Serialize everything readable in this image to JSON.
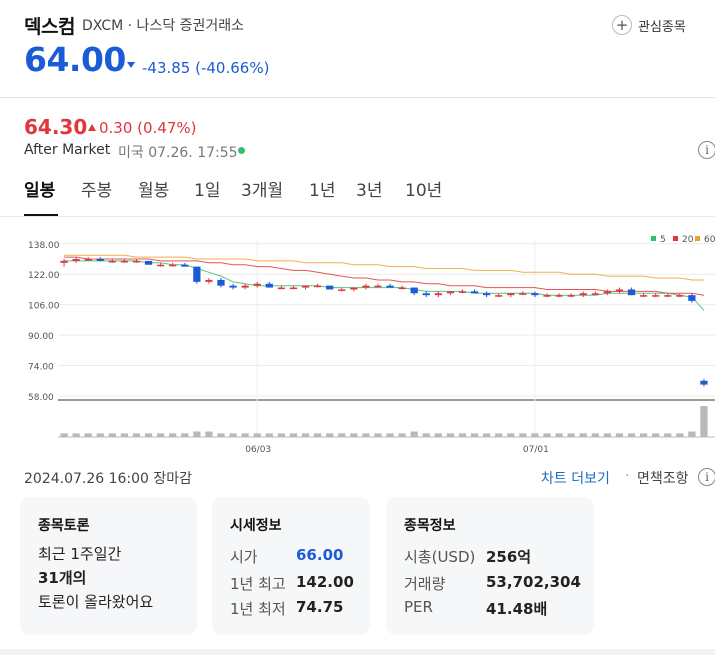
{
  "stock": {
    "name": "덱스컴",
    "ticker_exchange": "DXCM · 나스닥 증권거래소",
    "watch_label": "관심종목",
    "price": "64.00",
    "change": "-43.85 (-40.66%)"
  },
  "after_market": {
    "price": "64.30",
    "change": "0.30 (0.47%)",
    "label": "After Market",
    "time": "미국 07.26. 17:55"
  },
  "tabs": [
    "일봉",
    "주봉",
    "월봉",
    "1일",
    "3개월",
    "1년",
    "3년",
    "10년"
  ],
  "legend": [
    "5",
    "20",
    "60"
  ],
  "colors": {
    "up": "#e0373a",
    "down": "#1c5bd6",
    "ma5": "#2ebf6f",
    "ma20": "#e0373a",
    "ma60": "#f0a030"
  },
  "chart_data": {
    "type": "candlestick",
    "y_ticks": [
      "138.00",
      "122.00",
      "106.00",
      "90.00",
      "74.00",
      "58.00"
    ],
    "ylim": [
      58,
      140
    ],
    "x_ticks": [
      "06/03",
      "07/01"
    ],
    "ohlc": [
      [
        128,
        130,
        126,
        129
      ],
      [
        129,
        131,
        128,
        130
      ],
      [
        130,
        131,
        129,
        130
      ],
      [
        130,
        131,
        129,
        129
      ],
      [
        129,
        130,
        128,
        129
      ],
      [
        129,
        130,
        128,
        129
      ],
      [
        129,
        130,
        128,
        129
      ],
      [
        129,
        129,
        127,
        127
      ],
      [
        127,
        128,
        126,
        127
      ],
      [
        127,
        128,
        126,
        127
      ],
      [
        127,
        128,
        126,
        126
      ],
      [
        126,
        126,
        117,
        118
      ],
      [
        118,
        120,
        117,
        119
      ],
      [
        119,
        120,
        115,
        116
      ],
      [
        116,
        117,
        114,
        115
      ],
      [
        115,
        117,
        114,
        116
      ],
      [
        116,
        118,
        115,
        117
      ],
      [
        117,
        118,
        115,
        115
      ],
      [
        115,
        116,
        114,
        115
      ],
      [
        115,
        116,
        114,
        115
      ],
      [
        115,
        116,
        114,
        116
      ],
      [
        116,
        117,
        115,
        116
      ],
      [
        116,
        116,
        114,
        114
      ],
      [
        114,
        115,
        113,
        114
      ],
      [
        114,
        115,
        113,
        115
      ],
      [
        115,
        117,
        114,
        116
      ],
      [
        116,
        117,
        115,
        116
      ],
      [
        116,
        117,
        115,
        115
      ],
      [
        115,
        116,
        114,
        115
      ],
      [
        115,
        115,
        111,
        112
      ],
      [
        112,
        113,
        110,
        111
      ],
      [
        111,
        113,
        110,
        112
      ],
      [
        112,
        113,
        111,
        113
      ],
      [
        113,
        114,
        112,
        113
      ],
      [
        113,
        114,
        112,
        112
      ],
      [
        112,
        113,
        110,
        111
      ],
      [
        111,
        112,
        110,
        111
      ],
      [
        111,
        112,
        110,
        112
      ],
      [
        112,
        113,
        111,
        112
      ],
      [
        112,
        113,
        110,
        111
      ],
      [
        111,
        112,
        110,
        111
      ],
      [
        111,
        112,
        110,
        111
      ],
      [
        111,
        112,
        110,
        111
      ],
      [
        111,
        113,
        110,
        112
      ],
      [
        112,
        113,
        111,
        112
      ],
      [
        112,
        114,
        111,
        113
      ],
      [
        113,
        115,
        112,
        114
      ],
      [
        114,
        115,
        111,
        111
      ],
      [
        111,
        112,
        110,
        111
      ],
      [
        111,
        112,
        110,
        111
      ],
      [
        111,
        112,
        110,
        111
      ],
      [
        111,
        112,
        110,
        111
      ],
      [
        111,
        112,
        107,
        108
      ],
      [
        66,
        67,
        63,
        64
      ]
    ],
    "ma5": [
      129,
      129,
      129,
      129,
      129,
      129,
      129,
      128,
      128,
      127,
      127,
      125,
      123,
      121,
      118,
      117,
      116,
      116,
      116,
      116,
      116,
      116,
      115,
      115,
      115,
      115,
      115,
      115,
      115,
      114,
      113,
      113,
      113,
      113,
      112,
      112,
      112,
      112,
      112,
      112,
      111,
      111,
      111,
      111,
      111,
      112,
      112,
      112,
      112,
      112,
      112,
      111,
      110,
      103
    ],
    "ma20": [
      131,
      131,
      130,
      130,
      130,
      130,
      130,
      130,
      129,
      129,
      129,
      129,
      128,
      128,
      127,
      127,
      126,
      126,
      125,
      124,
      124,
      123,
      122,
      121,
      120,
      120,
      119,
      119,
      118,
      118,
      117,
      117,
      116,
      116,
      116,
      115,
      115,
      115,
      115,
      115,
      114,
      114,
      114,
      114,
      114,
      113,
      113,
      113,
      113,
      113,
      112,
      112,
      112,
      111
    ],
    "ma60": [
      132,
      132,
      132,
      132,
      132,
      132,
      131,
      131,
      131,
      131,
      131,
      130,
      130,
      130,
      130,
      130,
      129,
      129,
      129,
      129,
      128,
      128,
      128,
      128,
      127,
      127,
      127,
      126,
      126,
      126,
      125,
      125,
      125,
      125,
      124,
      124,
      124,
      124,
      123,
      123,
      123,
      123,
      122,
      122,
      122,
      121,
      121,
      121,
      121,
      120,
      120,
      120,
      119,
      119
    ],
    "volume": [
      2,
      2,
      2,
      2,
      2,
      2,
      2,
      2,
      2,
      2,
      2,
      3,
      3,
      2,
      2,
      2,
      2,
      2,
      2,
      2,
      2,
      2,
      2,
      2,
      2,
      2,
      2,
      2,
      2,
      3,
      2,
      2,
      2,
      2,
      2,
      2,
      2,
      2,
      2,
      2,
      2,
      2,
      2,
      2,
      2,
      2,
      2,
      2,
      2,
      2,
      2,
      2,
      3,
      17
    ]
  },
  "status": {
    "datetime": "2024.07.26 16:00 장마감",
    "more_chart": "차트 더보기",
    "separator": "·",
    "disclaimer": "면책조항"
  },
  "cards": {
    "discussion": {
      "title": "종목토론",
      "line1": "최근 1주일간",
      "line2": "31개의",
      "line3": "토론이 올라왔어요"
    },
    "quote": {
      "title": "시세정보",
      "rows": [
        {
          "label": "시가",
          "value": "66.00"
        },
        {
          "label": "1년 최고",
          "value": "142.00"
        },
        {
          "label": "1년 최저",
          "value": "74.75"
        }
      ]
    },
    "info": {
      "title": "종목정보",
      "rows": [
        {
          "label": "시총(USD)",
          "value": "256억"
        },
        {
          "label": "거래량",
          "value": "53,702,304"
        },
        {
          "label": "PER",
          "value": "41.48배"
        }
      ]
    }
  }
}
